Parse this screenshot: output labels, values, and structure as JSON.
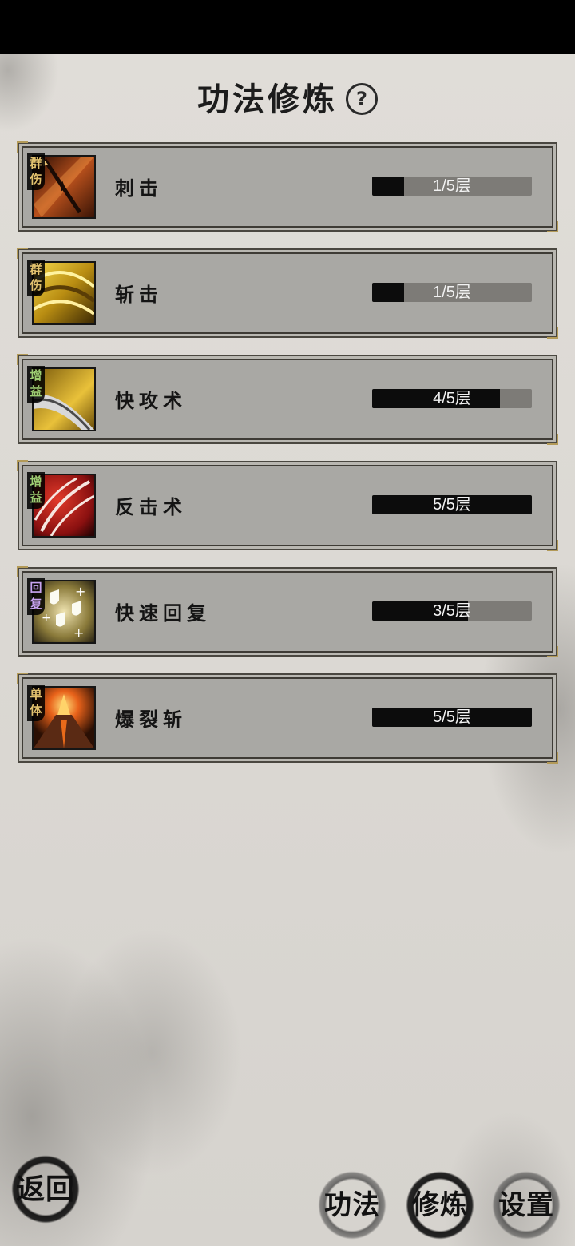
{
  "header": {
    "title": "功法修炼",
    "help_icon": "?"
  },
  "skills": [
    {
      "name": "刺击",
      "tag": [
        "群",
        "伤"
      ],
      "tag_color": "gold",
      "icon": "spear-thrust-icon",
      "level": 1,
      "max_level": 5,
      "level_text": "1/5层"
    },
    {
      "name": "斩击",
      "tag": [
        "群",
        "伤"
      ],
      "tag_color": "gold",
      "icon": "golden-slash-icon",
      "level": 1,
      "max_level": 5,
      "level_text": "1/5层"
    },
    {
      "name": "快攻术",
      "tag": [
        "增",
        "益"
      ],
      "tag_color": "green",
      "icon": "blade-icon",
      "level": 4,
      "max_level": 5,
      "level_text": "4/5层"
    },
    {
      "name": "反击术",
      "tag": [
        "增",
        "益"
      ],
      "tag_color": "green",
      "icon": "red-claw-icon",
      "level": 5,
      "max_level": 5,
      "level_text": "5/5层"
    },
    {
      "name": "快速回复",
      "tag": [
        "回",
        "复"
      ],
      "tag_color": "purple",
      "icon": "shields-icon",
      "level": 3,
      "max_level": 5,
      "level_text": "3/5层"
    },
    {
      "name": "爆裂斩",
      "tag": [
        "单",
        "体"
      ],
      "tag_color": "gold",
      "icon": "volcano-icon",
      "level": 5,
      "max_level": 5,
      "level_text": "5/5层"
    }
  ],
  "footer": {
    "back_label": "返回",
    "nav": {
      "gongfa": "功法",
      "xiulian": "修炼",
      "shezhi": "设置"
    },
    "active": "修炼"
  }
}
